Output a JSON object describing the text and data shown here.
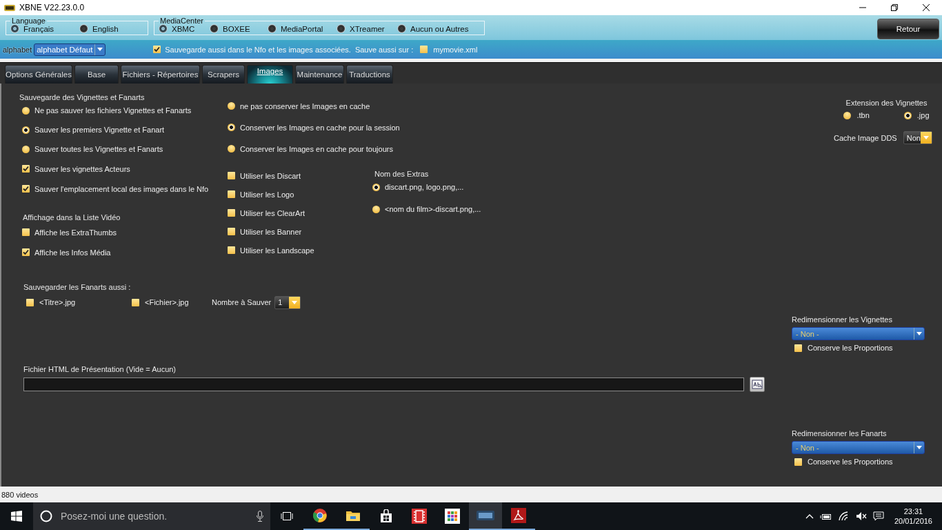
{
  "window": {
    "title": "XBNE V22.23.0.0"
  },
  "language": {
    "label": "Language",
    "options": [
      {
        "label": "Français",
        "selected": true
      },
      {
        "label": "English",
        "selected": false
      }
    ]
  },
  "media_center": {
    "label": "MediaCenter",
    "options": [
      {
        "label": "XBMC",
        "selected": true
      },
      {
        "label": "BOXEE",
        "selected": false
      },
      {
        "label": "MediaPortal",
        "selected": false
      },
      {
        "label": "XTreamer",
        "selected": false
      },
      {
        "label": "Aucun ou Autres",
        "selected": false
      }
    ]
  },
  "alphabet": {
    "label": "alphabet",
    "value": "alphabet Défaut"
  },
  "nfo_save": {
    "label": "Sauvegarde aussi dans le Nfo et les images associées.",
    "checked": true
  },
  "also_save": {
    "label": "Sauve aussi sur :",
    "option": {
      "label": "mymovie.xml",
      "checked": false
    }
  },
  "back_button": "Retour",
  "tabs": [
    {
      "label": "Options Générales",
      "selected": false
    },
    {
      "label": "Base",
      "selected": false
    },
    {
      "label": "Fichiers - Répertoires",
      "selected": false
    },
    {
      "label": "Scrapers",
      "selected": false
    },
    {
      "label": "Images",
      "selected": true
    },
    {
      "label": "Maintenance",
      "selected": false
    },
    {
      "label": "Traductions",
      "selected": false
    }
  ],
  "save_group": {
    "title": "Sauvegarde des Vignettes et Fanarts",
    "items": [
      {
        "kind": "radio",
        "label": "Ne pas sauver les fichiers Vignettes et Fanarts",
        "selected": false
      },
      {
        "kind": "radio",
        "label": "Sauver les premiers Vignette et Fanart",
        "selected": true
      },
      {
        "kind": "radio",
        "label": "Sauver toutes les Vignettes et Fanarts",
        "selected": false
      },
      {
        "kind": "checkbox",
        "label": "Sauver les vignettes Acteurs",
        "checked": true
      },
      {
        "kind": "checkbox",
        "label": "Sauver l'emplacement local des images dans le Nfo",
        "checked": true
      }
    ]
  },
  "display_group": {
    "title": "Affichage dans la Liste Vidéo",
    "items": [
      {
        "label": "Affiche les ExtraThumbs",
        "checked": false
      },
      {
        "label": "Affiche les Infos Média",
        "checked": true
      }
    ]
  },
  "cache_options": [
    {
      "label": "ne pas conserver les Images en cache",
      "selected": false
    },
    {
      "label": "Conserver les Images en cache pour la session",
      "selected": true
    },
    {
      "label": "Conserver les Images en cache pour toujours",
      "selected": false
    }
  ],
  "use_options": [
    {
      "label": "Utiliser les Discart",
      "checked": false
    },
    {
      "label": "Utiliser les Logo",
      "checked": false
    },
    {
      "label": "Utiliser les ClearArt",
      "checked": false
    },
    {
      "label": "Utiliser les Banner",
      "checked": false
    },
    {
      "label": "Utiliser les Landscape",
      "checked": false
    }
  ],
  "extras": {
    "title": "Nom des Extras",
    "options": [
      {
        "label": "discart.png, logo.png,...",
        "selected": true
      },
      {
        "label": "<nom du film>-discart.png,...",
        "selected": false
      }
    ]
  },
  "fanarts_also": {
    "title": "Sauvegarder les Fanarts aussi :",
    "options": [
      {
        "label": "<Titre>.jpg",
        "checked": false
      },
      {
        "label": "<Fichier>.jpg",
        "checked": false
      }
    ],
    "count": {
      "label": "Nombre à Sauver",
      "value": "1"
    }
  },
  "html_file": {
    "label": "Fichier HTML de Présentation (Vide = Aucun)"
  },
  "extension": {
    "title": "Extension des Vignettes",
    "options": [
      {
        "label": ".tbn",
        "selected": false
      },
      {
        "label": ".jpg",
        "selected": true
      }
    ]
  },
  "dds_cache": {
    "label": "Cache Image DDS",
    "value": "Non"
  },
  "resize_thumbs": {
    "title": "Redimensionner les Vignettes",
    "value": "- Non -",
    "keep": {
      "label": "Conserve les Proportions",
      "checked": false
    }
  },
  "resize_fanarts": {
    "title": "Redimensionner les Fanarts",
    "value": "- Non -",
    "keep": {
      "label": "Conserve les Proportions",
      "checked": false
    }
  },
  "status_bar": "880 videos",
  "taskbar": {
    "search_placeholder": "Posez-moi une question.",
    "time": "23:31",
    "date": "20/01/2016"
  }
}
